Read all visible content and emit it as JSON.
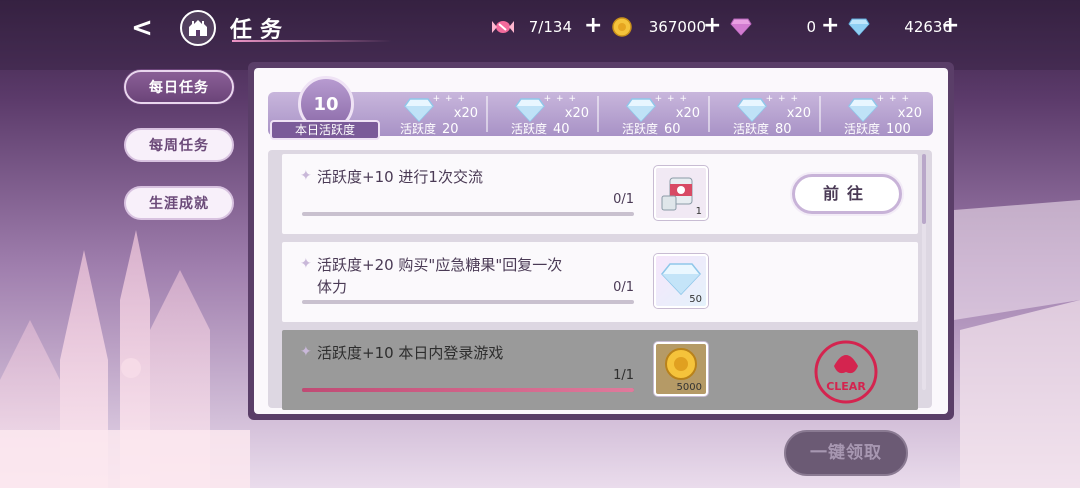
{
  "header": {
    "title": "任务",
    "resources": [
      {
        "icon": "candy-icon",
        "value": "7/134"
      },
      {
        "icon": "gold-coin-icon",
        "value": "367000"
      },
      {
        "icon": "pink-diamond-icon",
        "value": "0"
      },
      {
        "icon": "blue-diamond-icon",
        "value": "42636"
      }
    ],
    "plus": "+"
  },
  "sidebar": {
    "tabs": [
      {
        "label": "每日任务",
        "active": true
      },
      {
        "label": "每周任务",
        "active": false
      },
      {
        "label": "生涯成就",
        "active": false
      }
    ]
  },
  "activity": {
    "current": "10",
    "label": "本日活跃度",
    "milestones": [
      {
        "dots": "+ + +",
        "reward_icon": "diamond-icon",
        "multiplier": "x20",
        "caption": "活跃度",
        "threshold": "20"
      },
      {
        "dots": "+ + +",
        "reward_icon": "diamond-icon",
        "multiplier": "x20",
        "caption": "活跃度",
        "threshold": "40"
      },
      {
        "dots": "+ + +",
        "reward_icon": "diamond-icon",
        "multiplier": "x20",
        "caption": "活跃度",
        "threshold": "60"
      },
      {
        "dots": "+ + +",
        "reward_icon": "diamond-icon",
        "multiplier": "x20",
        "caption": "活跃度",
        "threshold": "80"
      },
      {
        "dots": "+ + +",
        "reward_icon": "diamond-icon",
        "multiplier": "x20",
        "caption": "活跃度",
        "threshold": "100"
      }
    ]
  },
  "tasks": [
    {
      "star": "✦",
      "name": "活跃度+10  进行1次交流",
      "progress": "0/1",
      "progress_fraction": 0,
      "reward_icon": "canned-food-icon",
      "reward_count": "1",
      "button": "前往",
      "done": false
    },
    {
      "star": "✦",
      "name": "活跃度+20  购买\"应急糖果\"回复一次体力",
      "progress": "0/1",
      "progress_fraction": 0,
      "reward_icon": "diamond-icon",
      "reward_count": "50",
      "done": false
    },
    {
      "star": "✦",
      "name": "活跃度+10   本日内登录游戏",
      "progress": "1/1",
      "progress_fraction": 1,
      "reward_icon": "gold-coin-icon",
      "reward_count": "5000",
      "stamp": "CLEAR",
      "done": true
    }
  ],
  "footer": {
    "claim_all": "一键领取"
  },
  "colors": {
    "accent": "#6b4479",
    "progress": "#c04a74",
    "clear_stamp": "#d4244f"
  }
}
